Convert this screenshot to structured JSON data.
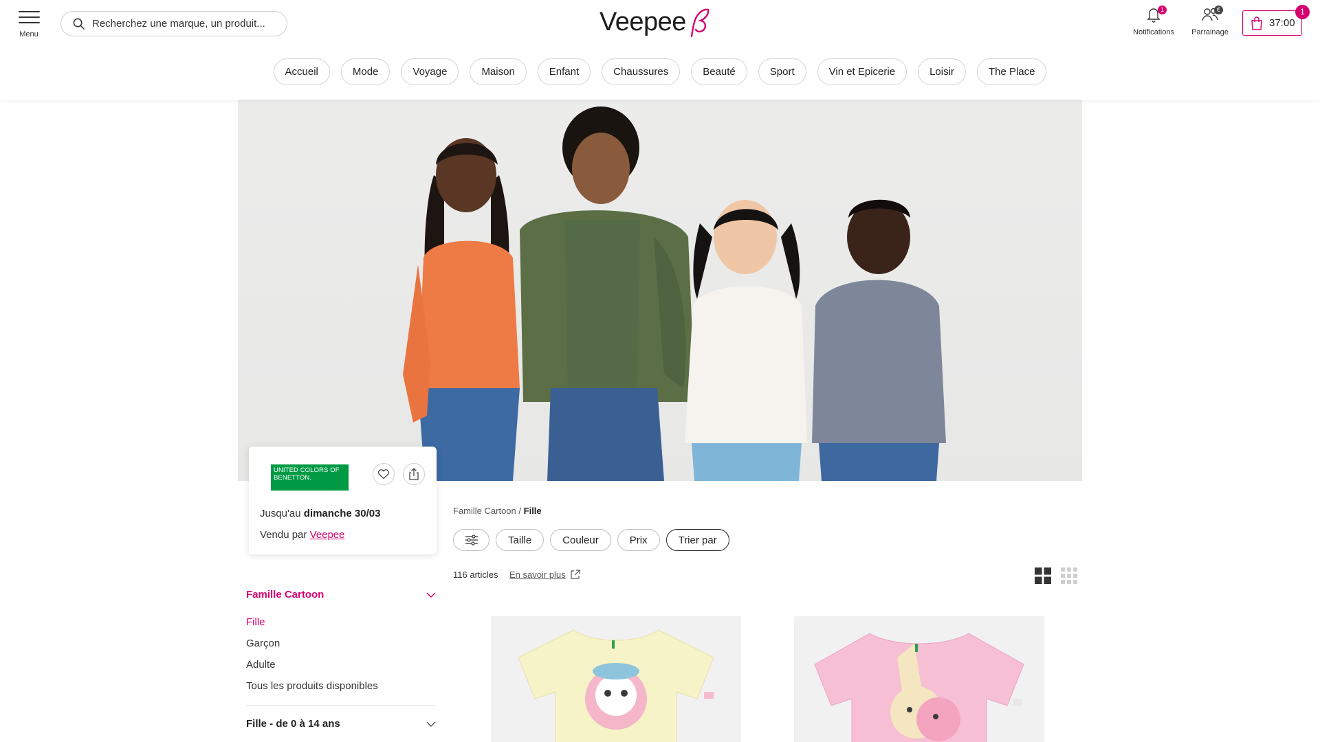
{
  "header": {
    "menu_label": "Menu",
    "search_placeholder": "Recherchez une marque, un produit...",
    "logo_text": "Veepee",
    "notifications": {
      "label": "Notifications",
      "badge": "1"
    },
    "referral": {
      "label": "Parrainage",
      "badge": "€"
    },
    "cart": {
      "timer": "37:00",
      "badge": "1"
    },
    "colors": {
      "brand_pink": "#d6006f"
    }
  },
  "nav": {
    "categories": [
      "Accueil",
      "Mode",
      "Voyage",
      "Maison",
      "Enfant",
      "Chaussures",
      "Beauté",
      "Sport",
      "Vin et Epicerie",
      "Loisir",
      "The Place"
    ]
  },
  "brand_card": {
    "logo_text": "UNITED COLORS OF BENETTON.",
    "logo_color": "#009a44",
    "until_prefix": "Jusqu'au",
    "until_date": "dimanche 30/03",
    "sold_by_prefix": "Vendu par",
    "sold_by": "Veepee"
  },
  "sidebar": {
    "section_title": "Famille Cartoon",
    "items": [
      {
        "label": "Fille",
        "active": true
      },
      {
        "label": "Garçon",
        "active": false
      },
      {
        "label": "Adulte",
        "active": false
      },
      {
        "label": "Tous les produits disponibles",
        "active": false
      }
    ],
    "section2_title": "Fille - de 0 à 14 ans"
  },
  "listing": {
    "breadcrumb_parent": "Famille Cartoon",
    "breadcrumb_sep": "/",
    "breadcrumb_current": "Fille",
    "filters": [
      "Taille",
      "Couleur",
      "Prix"
    ],
    "sort_label": "Trier par",
    "count": "116 articles",
    "learn_more": "En savoir plus",
    "products": [
      {
        "color": "yellow t-shirt",
        "shirt_color": "#f7f3c8"
      },
      {
        "color": "pink t-shirt",
        "shirt_color": "#f7bfd4"
      }
    ]
  }
}
